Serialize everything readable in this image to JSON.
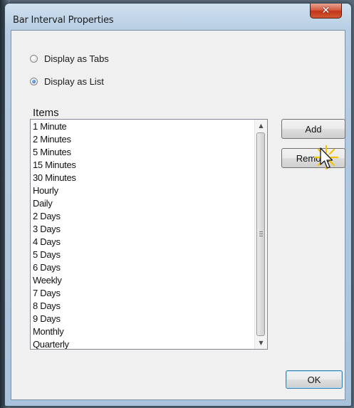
{
  "window": {
    "title": "Bar Interval Properties",
    "close_glyph": "✕"
  },
  "display_mode": {
    "options": [
      {
        "label": "Display as Tabs",
        "checked": false
      },
      {
        "label": "Display as List",
        "checked": true
      }
    ]
  },
  "items": {
    "label": "Items",
    "list": [
      "1 Minute",
      "2 Minutes",
      "5 Minutes",
      "15 Minutes",
      "30 Minutes",
      "Hourly",
      "Daily",
      "2 Days",
      "3 Days",
      "4 Days",
      "5 Days",
      "6 Days",
      "Weekly",
      "7 Days",
      "8 Days",
      "9 Days",
      "Monthly",
      "Quarterly"
    ]
  },
  "buttons": {
    "add_label": "Add",
    "remove_label": "Remove",
    "ok_label": "OK"
  },
  "icons": {
    "close": "close-icon",
    "scroll_up": "scroll-up-icon",
    "scroll_down": "scroll-down-icon",
    "cursor": "mouse-pointer-icon",
    "click_highlight": "click-highlight-icon"
  },
  "colors": {
    "close_button": "#c9402a",
    "click_highlight": "#f5c400",
    "radio_selected": "#1b57b5"
  }
}
